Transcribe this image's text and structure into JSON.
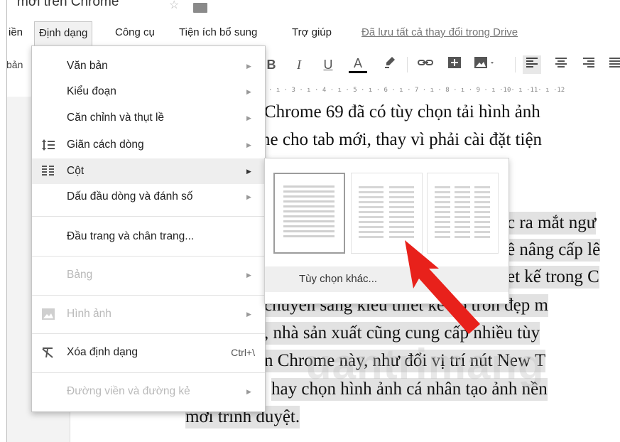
{
  "window": {
    "doc_title": "mới trên Chrome",
    "star_icon": "star-icon",
    "folder_icon": "folder-icon"
  },
  "menubar": {
    "items": [
      {
        "label": "iền"
      },
      {
        "label": "Định dạng",
        "active": true
      },
      {
        "label": "Công cụ"
      },
      {
        "label": "Tiện ích bổ sung"
      },
      {
        "label": "Trợ giúp"
      }
    ],
    "save_status": "Đã lưu tất cả thay đổi trong Drive"
  },
  "toolbar": {
    "style_fragment": "bản",
    "bold": "B",
    "italic": "I",
    "underline": "U",
    "text_color": "A",
    "icons": [
      "highlight-pen-icon",
      "link-icon",
      "insert-comment-icon",
      "insert-image-icon",
      "align-left-icon",
      "align-center-icon",
      "align-right-icon",
      "align-justify-icon"
    ]
  },
  "ruler": {
    "text": "· ı · 3 · ı · 4 · ı · 5 · ı · 6 · ı · 7 · ı · 8 · ı · 9 · ı ·10· ı ·11· ı ·12"
  },
  "document": {
    "lines": [
      "Chrome 69 đã có tùy chọn tải hình ảnh",
      "ne cho tab mới, thay vì phải cài đặt tiện",
      "c ra mắt ngư",
      "ề nâng cấp lê",
      "et kế trong C",
      "chuyển sang kiểu thiết kế bo tròn đẹp m",
      ", nhà sản xuất cũng cung cấp nhiều tùy",
      "n Chrome này, như đổi vị trí nút New T",
      "hay chọn hình ảnh cá nhân tạo ảnh nền",
      "mới trình duyệt."
    ],
    "watermark": "uantrimang"
  },
  "format_menu": {
    "items": [
      {
        "label": "Văn bản",
        "icon": "",
        "submenu": true,
        "disabled": false
      },
      {
        "label": "Kiểu đoạn",
        "icon": "",
        "submenu": true,
        "disabled": false
      },
      {
        "label": "Căn chỉnh và thụt lề",
        "icon": "",
        "submenu": true,
        "disabled": false
      },
      {
        "label": "Giãn cách dòng",
        "icon": "line-spacing-icon",
        "submenu": true,
        "disabled": false
      },
      {
        "label": "Cột",
        "icon": "columns-icon",
        "submenu": true,
        "disabled": false,
        "hover": true
      },
      {
        "label": "Dấu đầu dòng và đánh số",
        "icon": "",
        "submenu": true,
        "disabled": false
      },
      {
        "label": "Đầu trang và chân trang...",
        "icon": "",
        "submenu": false,
        "disabled": false
      },
      {
        "label": "Bảng",
        "icon": "",
        "submenu": true,
        "disabled": true
      },
      {
        "label": "Hình ảnh",
        "icon": "image-icon",
        "submenu": true,
        "disabled": true
      },
      {
        "label": "Xóa định dạng",
        "icon": "clear-formatting-icon",
        "submenu": false,
        "disabled": false,
        "shortcut": "Ctrl+\\"
      },
      {
        "label": "Đường viền và đường kẻ",
        "icon": "",
        "submenu": true,
        "disabled": true
      }
    ]
  },
  "columns_submenu": {
    "options": [
      {
        "name": "one-column",
        "columns": 1,
        "selected": true
      },
      {
        "name": "two-columns",
        "columns": 2,
        "selected": false
      },
      {
        "name": "three-columns",
        "columns": 3,
        "selected": false
      }
    ],
    "more_options": "Tùy chọn khác..."
  },
  "colors": {
    "annotation_arrow": "#e8211b",
    "hover_bg": "#eeeeee",
    "disabled_text": "#b9b9b9"
  }
}
